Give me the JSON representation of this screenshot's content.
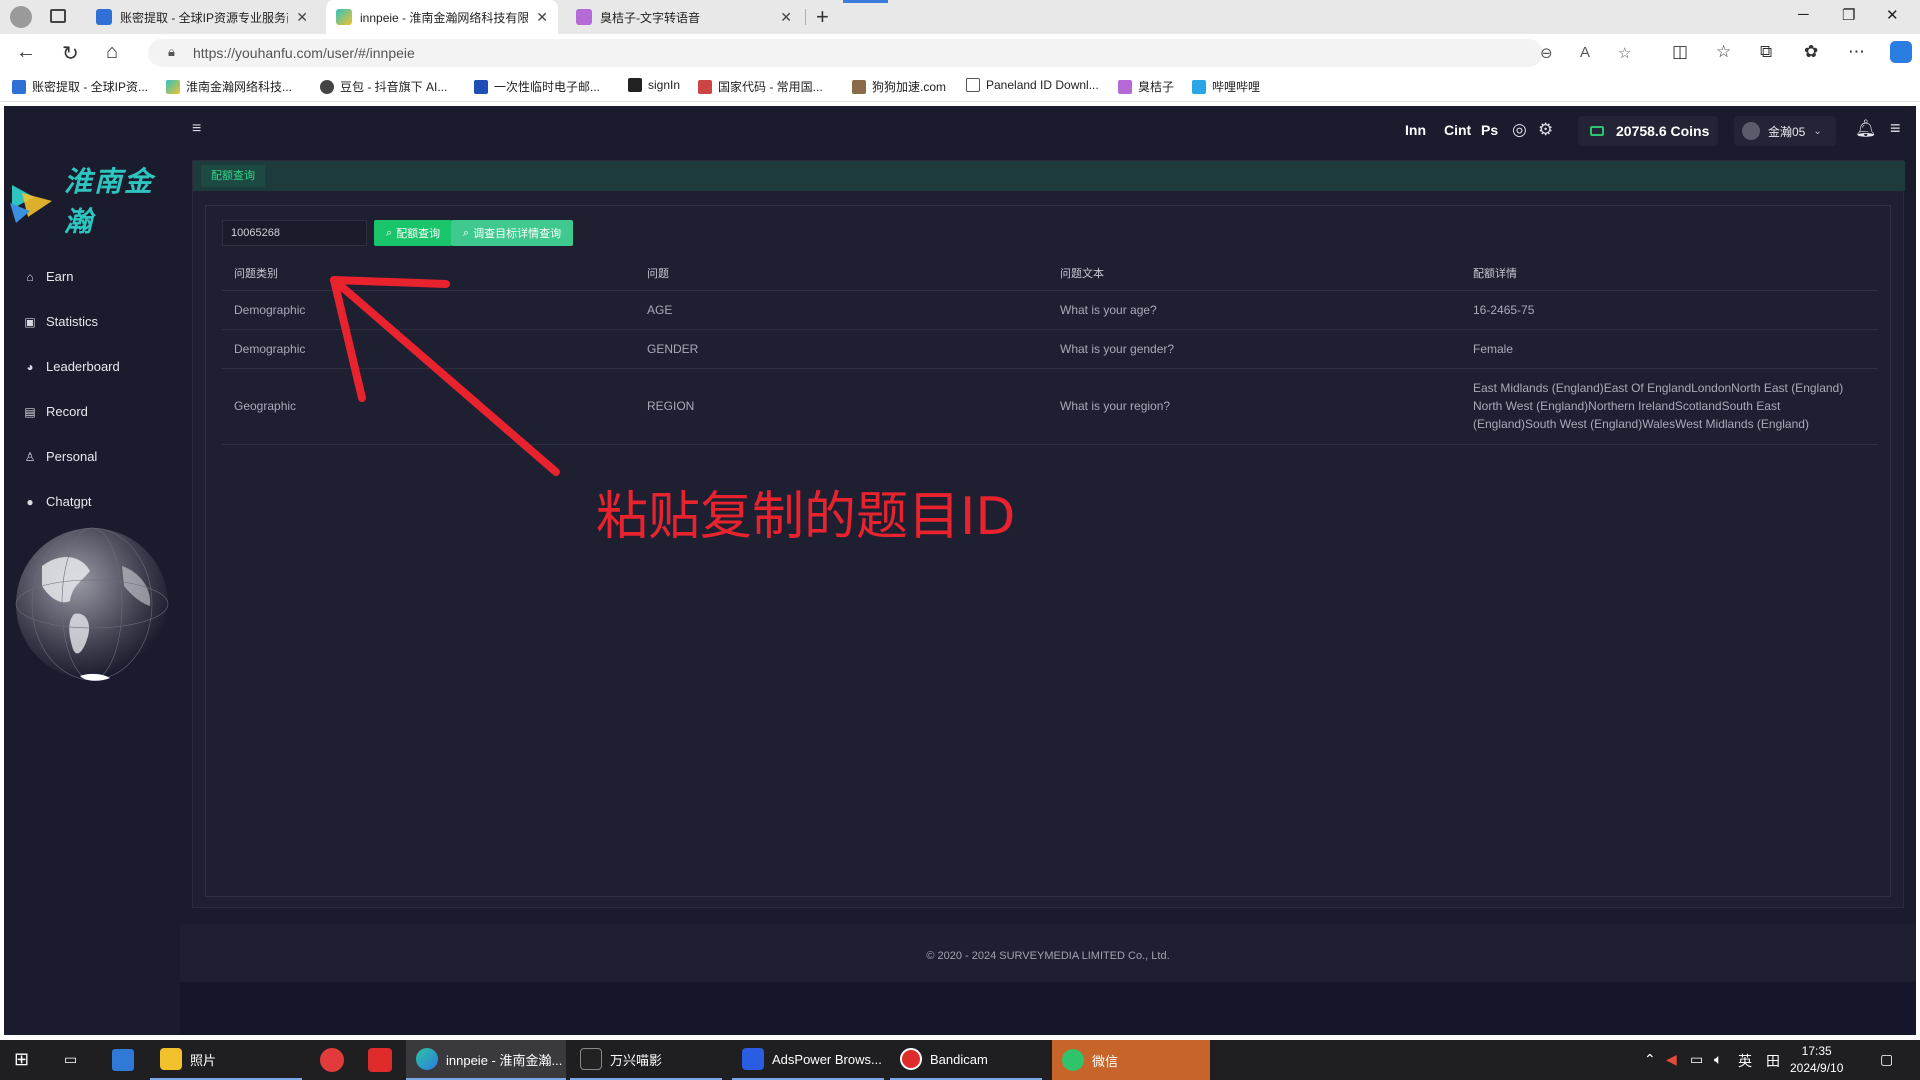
{
  "browser": {
    "tabs": [
      {
        "label": "账密提取 - 全球IP资源专业服务商",
        "active": false
      },
      {
        "label": "innpeie - 淮南金瀚网络科技有限公",
        "active": true
      },
      {
        "label": "臭桔子-文字转语音",
        "active": false
      }
    ],
    "url": "https://youhanfu.com/user/#/innpeie",
    "bookmarks": [
      "账密提取 - 全球IP资...",
      "淮南金瀚网络科技...",
      "豆包 - 抖音旗下 AI...",
      "一次性临时电子邮...",
      "signIn",
      "国家代码 - 常用国...",
      "狗狗加速.com",
      "Paneland ID Downl...",
      "臭桔子",
      "哔哩哔哩"
    ]
  },
  "app": {
    "logo_text": "淮南金瀚",
    "nav": [
      {
        "label": "Earn",
        "icon": "home-icon"
      },
      {
        "label": "Statistics",
        "icon": "chart-icon"
      },
      {
        "label": "Leaderboard",
        "icon": "pie-icon"
      },
      {
        "label": "Record",
        "icon": "record-icon"
      },
      {
        "label": "Personal",
        "icon": "user-icon"
      },
      {
        "label": "Chatgpt",
        "icon": "chat-icon"
      }
    ],
    "topbar": {
      "links": [
        "Inn",
        "Cint",
        "Ps"
      ],
      "coins": "20758.6 Coins",
      "username": "金瀚05"
    },
    "breadcrumb": "配额查询",
    "query": {
      "input_value": "10065268",
      "btn_quota": "配额查询",
      "btn_detail": "调查目标详情查询"
    },
    "table": {
      "headers": [
        "问题类别",
        "问题",
        "问题文本",
        "配额详情"
      ],
      "rows": [
        [
          "Demographic",
          "AGE",
          "What is your age?",
          "16-2465-75"
        ],
        [
          "Demographic",
          "GENDER",
          "What is your gender?",
          "Female"
        ],
        [
          "Geographic",
          "REGION",
          "What is your region?",
          "East Midlands (England)East Of EnglandLondonNorth East (England) North West (England)Northern IrelandScotlandSouth East (England)South West (England)WalesWest Midlands (England)"
        ]
      ]
    },
    "footer": "© 2020 - 2024 SURVEYMEDIA LIMITED Co., Ltd."
  },
  "annotation": {
    "text": "粘贴复制的题目ID",
    "color": "#e8232e"
  },
  "taskbar": {
    "apps": [
      "照片",
      "innpeie - 淮南金瀚...",
      "万兴喵影",
      "AdsPower Brows...",
      "Bandicam",
      "微信"
    ],
    "ime": "英",
    "time": "17:35",
    "date": "2024/9/10"
  }
}
